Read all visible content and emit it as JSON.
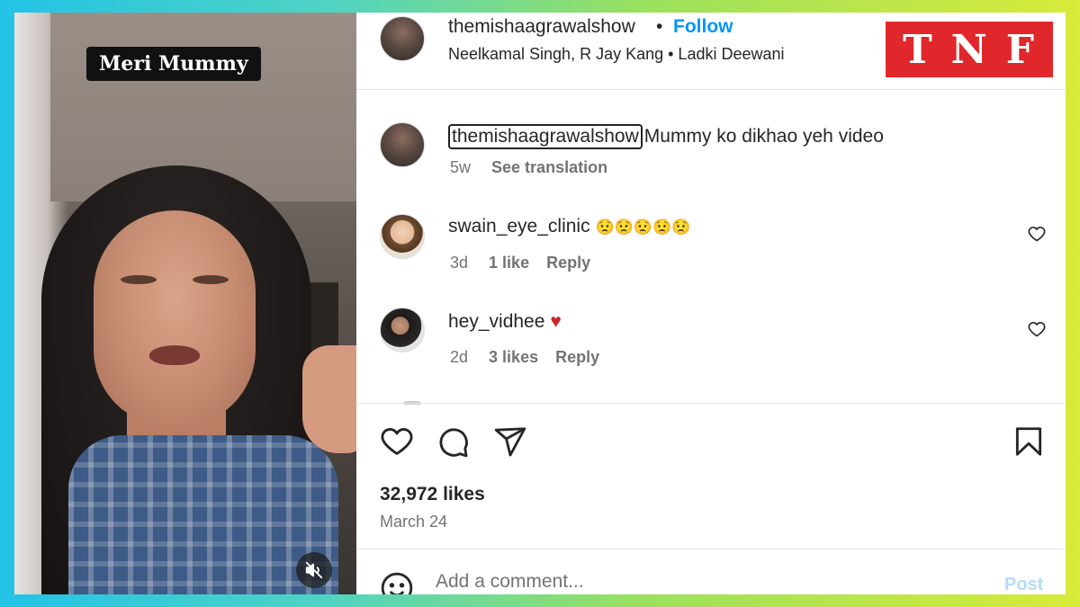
{
  "video": {
    "overlay_title": "Meri Mummy",
    "mute_icon": "speaker-muted-icon"
  },
  "header": {
    "username": "themishaagrawalshow",
    "separator": "•",
    "follow_label": "Follow",
    "audio": "Neelkamal Singh, R Jay Kang • Ladki Deewani"
  },
  "watermark": {
    "text": "TNF",
    "color": "#e0282c"
  },
  "caption": {
    "username": "themishaagrawalshow",
    "text": "Mummy ko dikhao yeh video",
    "time": "5w",
    "translation_label": "See translation"
  },
  "comments": [
    {
      "username": "swain_eye_clinic",
      "text": "😟😟😟😟😟",
      "time": "3d",
      "likes": "1 like",
      "reply_label": "Reply"
    },
    {
      "username": "hey_vidhee",
      "text": "♥",
      "time": "2d",
      "likes": "3 likes",
      "reply_label": "Reply"
    }
  ],
  "stats": {
    "likes": "32,972 likes",
    "date": "March 24"
  },
  "comment_box": {
    "placeholder": "Add a comment...",
    "post_label": "Post"
  },
  "colors": {
    "link": "#0095f6",
    "muted_text": "#737373",
    "post_disabled": "#b3dbff",
    "heart_red": "#c62828"
  },
  "icons": [
    "heart-icon",
    "comment-icon",
    "share-icon",
    "bookmark-icon",
    "emoji-icon",
    "small-heart-icon"
  ]
}
